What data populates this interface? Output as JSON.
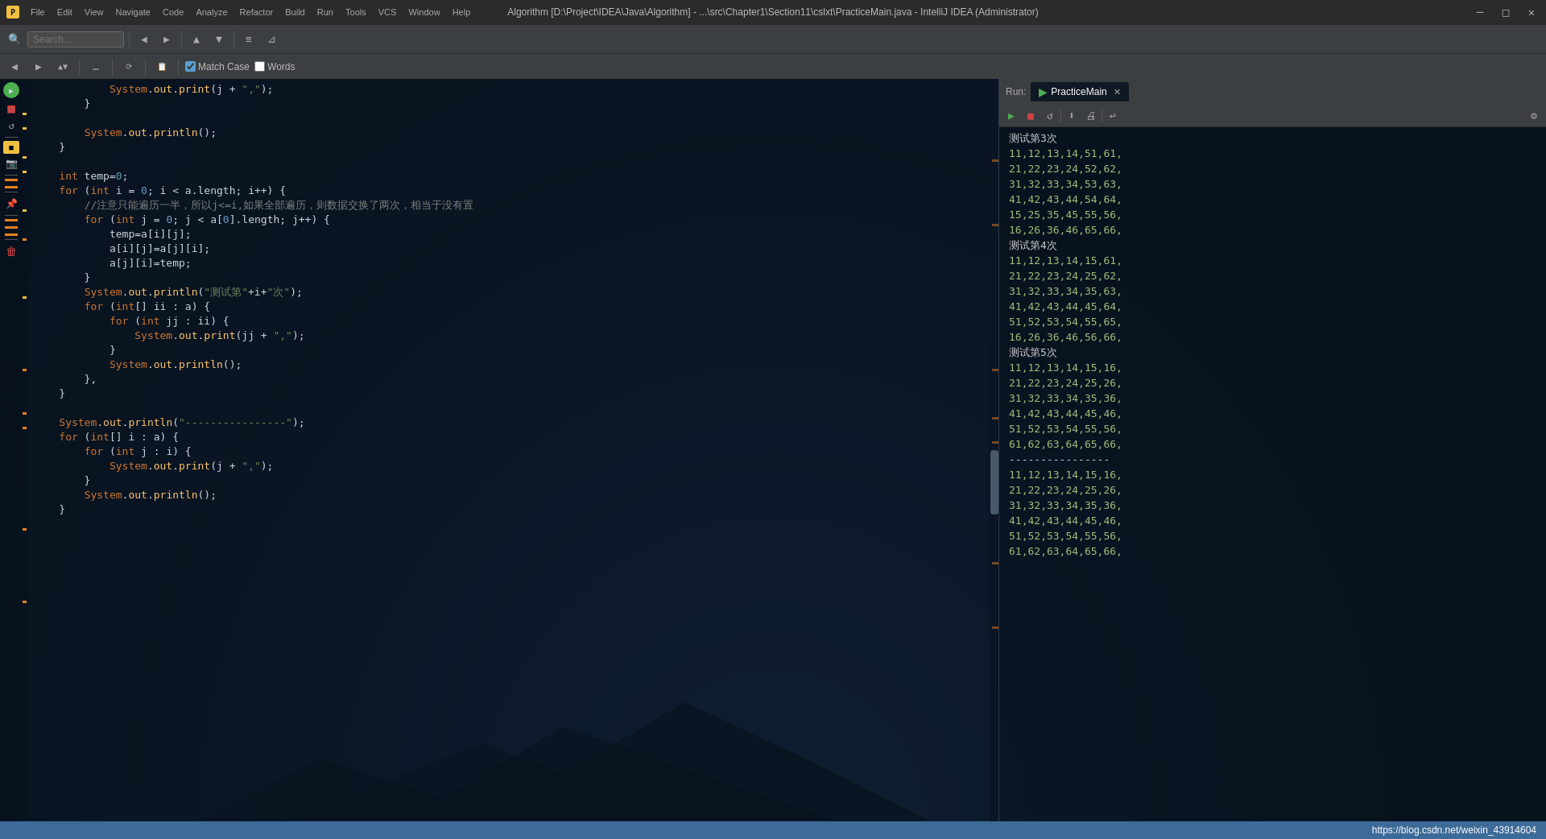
{
  "titleBar": {
    "title": "Algorithm [D:\\Project\\IDEA\\Java\\Algorithm] - ...\\src\\Chapter1\\Section11\\cslxt\\PracticeMain.java - IntelliJ IDEA (Administrator)",
    "minimize": "─",
    "maximize": "□",
    "close": "✕"
  },
  "menuBar": {
    "items": [
      "File",
      "Edit",
      "View",
      "Navigate",
      "Code",
      "Analyze",
      "Refactor",
      "Build",
      "Run",
      "Tools",
      "VCS",
      "Window",
      "Help"
    ]
  },
  "toolbar": {
    "search_placeholder": "Search..."
  },
  "findBar": {
    "placeholder": "",
    "match_case_label": "Match Case",
    "words_label": "Words",
    "match_case_checked": true,
    "words_checked": false
  },
  "editor": {
    "lines": [
      {
        "num": "",
        "code": "            System.out.print(j + \",\");"
      },
      {
        "num": "",
        "code": "        }"
      },
      {
        "num": "",
        "code": ""
      },
      {
        "num": "",
        "code": "        System.out.println();"
      },
      {
        "num": "",
        "code": "    }"
      },
      {
        "num": "",
        "code": ""
      },
      {
        "num": "",
        "code": "    int temp=0;"
      },
      {
        "num": "",
        "code": "    for (int i = 0; i < a.length; i++) {"
      },
      {
        "num": "",
        "code": "        //注意只能遍历一半，所以j<=i,如果全部遍历，则数据交换了两次，相当于没有置"
      },
      {
        "num": "",
        "code": "        for (int j = 0; j < a[0].length; j++) {"
      },
      {
        "num": "",
        "code": "            temp=a[i][j];"
      },
      {
        "num": "",
        "code": "            a[i][j]=a[j][i];"
      },
      {
        "num": "",
        "code": "            a[j][i]=temp;"
      },
      {
        "num": "",
        "code": "        }"
      },
      {
        "num": "",
        "code": "        System.out.println(\"测试第\"+i+\"次\");"
      },
      {
        "num": "",
        "code": "        for (int[] ii : a) {"
      },
      {
        "num": "",
        "code": "            for (int jj : ii) {"
      },
      {
        "num": "",
        "code": "                System.out.print(jj + \",\");"
      },
      {
        "num": "",
        "code": "            }"
      },
      {
        "num": "",
        "code": "            System.out.println();"
      },
      {
        "num": "",
        "code": "        },"
      },
      {
        "num": "",
        "code": "    }"
      },
      {
        "num": "",
        "code": ""
      },
      {
        "num": "",
        "code": "    System.out.println(\"----------------\");"
      },
      {
        "num": "",
        "code": "    for (int[] i : a) {"
      },
      {
        "num": "",
        "code": "        for (int j : i) {"
      },
      {
        "num": "",
        "code": "            System.out.print(j + \",\");"
      },
      {
        "num": "",
        "code": "        }"
      },
      {
        "num": "",
        "code": "        System.out.println();"
      },
      {
        "num": "",
        "code": "    }"
      }
    ]
  },
  "runPanel": {
    "tab_label": "PracticeMain",
    "run_label": "Run:",
    "output": [
      "测试第3次",
      "11,12,13,14,51,61,",
      "21,22,23,24,52,62,",
      "31,32,33,34,53,63,",
      "41,42,43,44,54,64,",
      "15,25,35,45,55,56,",
      "16,26,36,46,65,66,",
      "测试第4次",
      "11,12,13,14,15,61,",
      "21,22,23,24,25,62,",
      "31,32,33,34,35,63,",
      "41,42,43,44,45,64,",
      "51,52,53,54,55,65,",
      "16,26,36,46,56,66,",
      "测试第5次",
      "11,12,13,14,15,16,",
      "21,22,23,24,25,26,",
      "31,32,33,34,35,36,",
      "41,42,43,44,45,46,",
      "51,52,53,54,55,56,",
      "61,62,63,64,65,66,",
      "----------------",
      "11,12,13,14,15,16,",
      "21,22,23,24,25,26,",
      "31,32,33,34,35,36,",
      "41,42,43,44,45,46,",
      "51,52,53,54,55,56,",
      "61,62,63,64,65,66,"
    ]
  },
  "statusBar": {
    "url": "https://blog.csdn.net/weixin_43914604"
  },
  "colors": {
    "accent": "#5a9fd4",
    "background": "#0d1b2a",
    "editor_bg": "#0a1420",
    "toolbar_bg": "#3c3f41",
    "run_bg": "#0a1420"
  }
}
